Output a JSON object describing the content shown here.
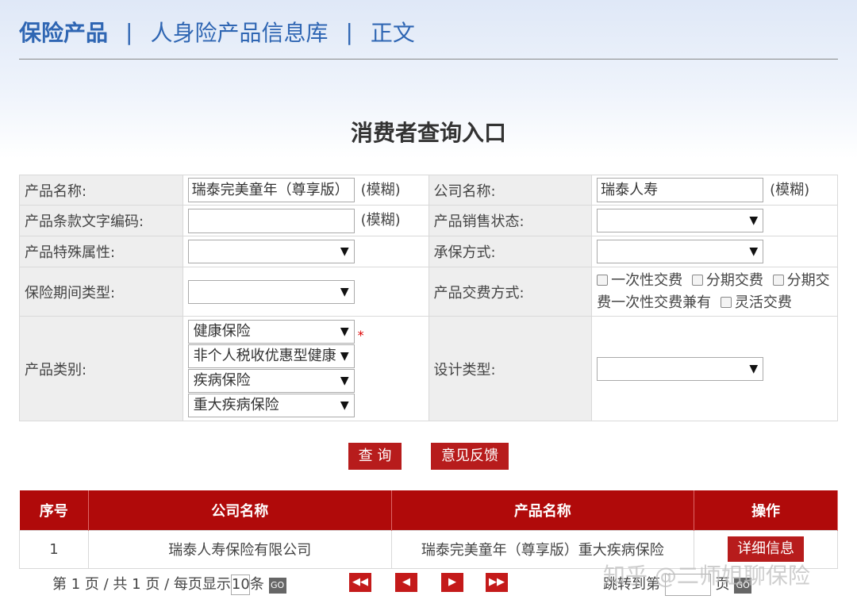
{
  "breadcrumb": {
    "home": "保险产品",
    "section": "人身险产品信息库",
    "current": "正文",
    "separator": "|"
  },
  "page_title": "消费者查询入口",
  "form": {
    "product_name_label": "产品名称:",
    "product_name_value": "瑞泰完美童年（尊享版）",
    "fuzzy": "(模糊)",
    "company_name_label": "公司名称:",
    "company_name_value": "瑞泰人寿",
    "clause_code_label": "产品条款文字编码:",
    "clause_code_value": "",
    "sales_status_label": "产品销售状态:",
    "sales_status_value": "",
    "special_attr_label": "产品特殊属性:",
    "special_attr_value": "",
    "underwriting_label": "承保方式:",
    "underwriting_value": "",
    "period_type_label": "保险期间类型:",
    "period_type_value": "",
    "payment_label": "产品交费方式:",
    "payment_options": [
      "一次性交费",
      "分期交费",
      "分期交费一次性交费兼有",
      "灵活交费"
    ],
    "category_label": "产品类别:",
    "category_values": [
      "健康保险",
      "非个人税收优惠型健康",
      "疾病保险",
      "重大疾病保险"
    ],
    "required_mark": "*",
    "design_type_label": "设计类型:",
    "design_type_value": ""
  },
  "buttons": {
    "query": "查 询",
    "feedback": "意见反馈"
  },
  "results": {
    "headers": [
      "序号",
      "公司名称",
      "产品名称",
      "操作"
    ],
    "rows": [
      {
        "index": "1",
        "company": "瑞泰人寿保险有限公司",
        "product": "瑞泰完美童年（尊享版）重大疾病保险",
        "action": "详细信息"
      }
    ]
  },
  "pager": {
    "prefix": "第",
    "current_page": "1",
    "mid1": "页 / 共",
    "total_pages": "1",
    "mid2": "页 / 每页显示",
    "per_page": "10",
    "suffix": "条",
    "go": "GO",
    "first": "◀◀",
    "prev": "◀",
    "next": "▶",
    "last": "▶▶",
    "jump_prefix": "跳转到第",
    "jump_suffix": "页"
  },
  "watermark": "知乎 @二师姐聊保险"
}
